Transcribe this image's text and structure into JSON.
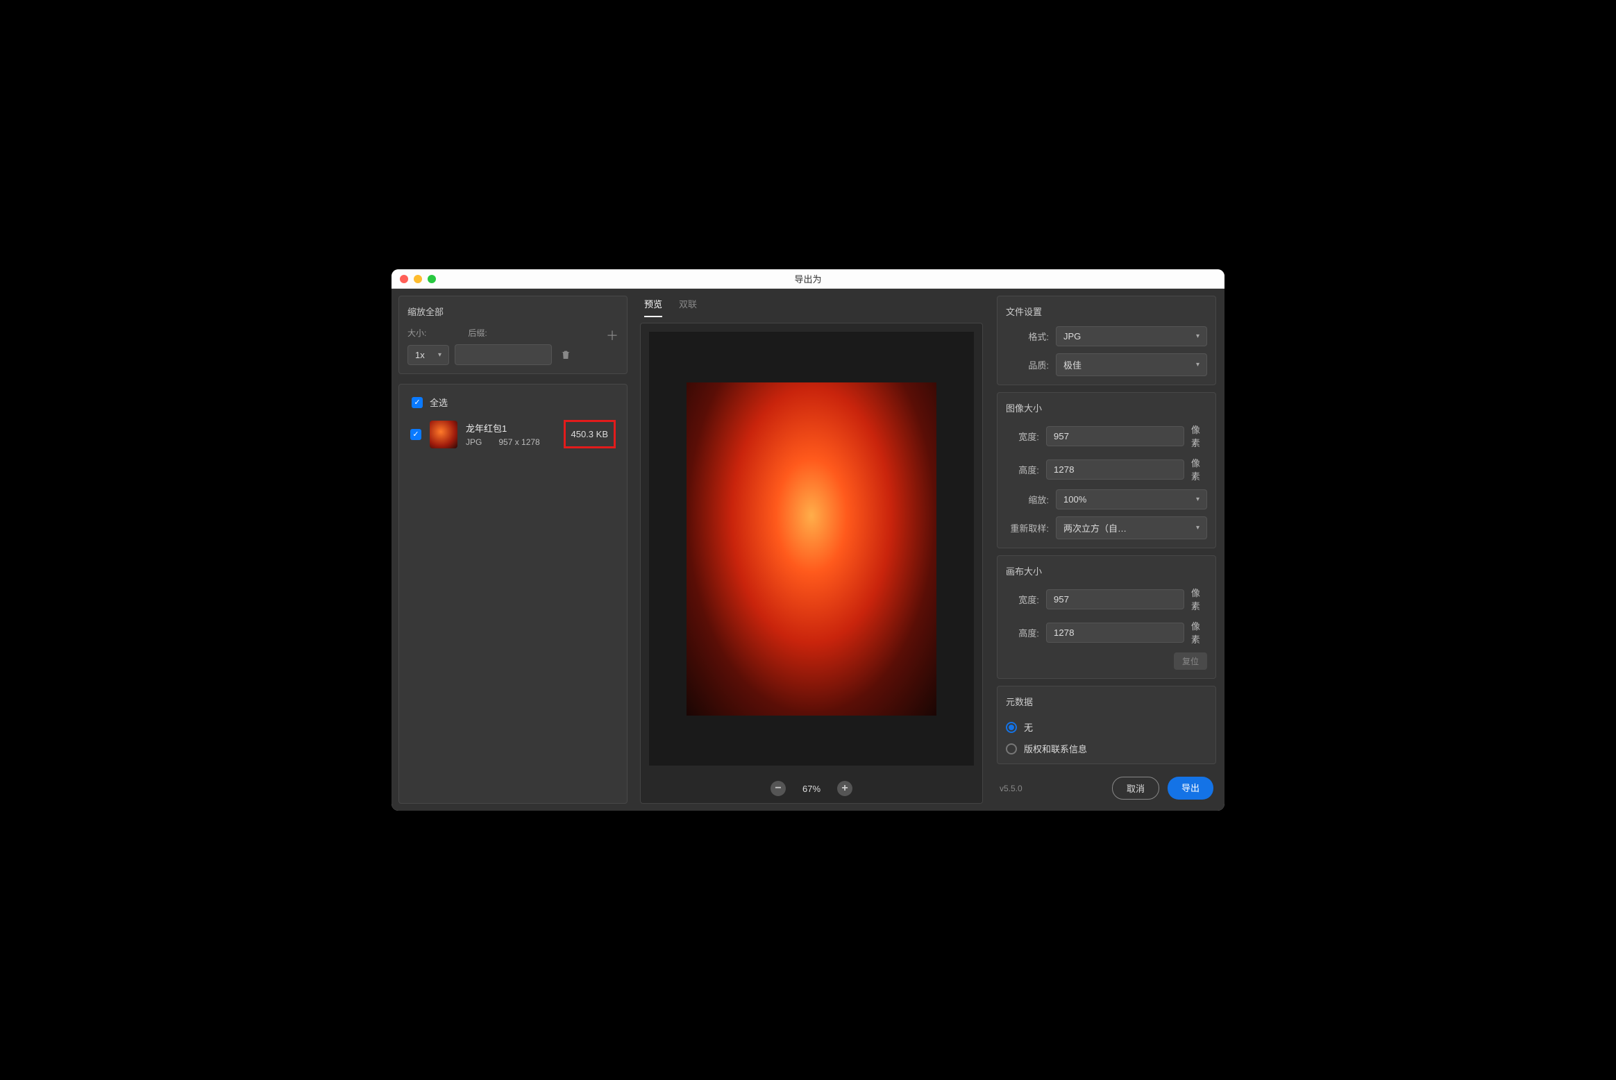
{
  "window": {
    "title": "导出为"
  },
  "left": {
    "scale_all": "缩放全部",
    "size_label": "大小:",
    "suffix_label": "后缀:",
    "scale_value": "1x",
    "select_all": "全选",
    "item": {
      "name": "龙年红包1",
      "format": "JPG",
      "dimensions": "957 x 1278",
      "filesize": "450.3 KB"
    }
  },
  "center": {
    "tab_preview": "预览",
    "tab_dual": "双联",
    "zoom": "67%"
  },
  "right": {
    "file_settings": "文件设置",
    "format_label": "格式:",
    "format_value": "JPG",
    "quality_label": "品质:",
    "quality_value": "极佳",
    "image_size": "图像大小",
    "width_label": "宽度:",
    "height_label": "高度:",
    "pixels": "像素",
    "img_width": "957",
    "img_height": "1278",
    "scale_label": "缩放:",
    "scale_value": "100%",
    "resample_label": "重新取样:",
    "resample_value": "两次立方（自…",
    "canvas_size": "画布大小",
    "canvas_width": "957",
    "canvas_height": "1278",
    "reset": "复位",
    "metadata": "元数据",
    "meta_none": "无",
    "meta_copyright": "版权和联系信息"
  },
  "footer": {
    "version": "v5.5.0",
    "cancel": "取消",
    "export": "导出"
  }
}
